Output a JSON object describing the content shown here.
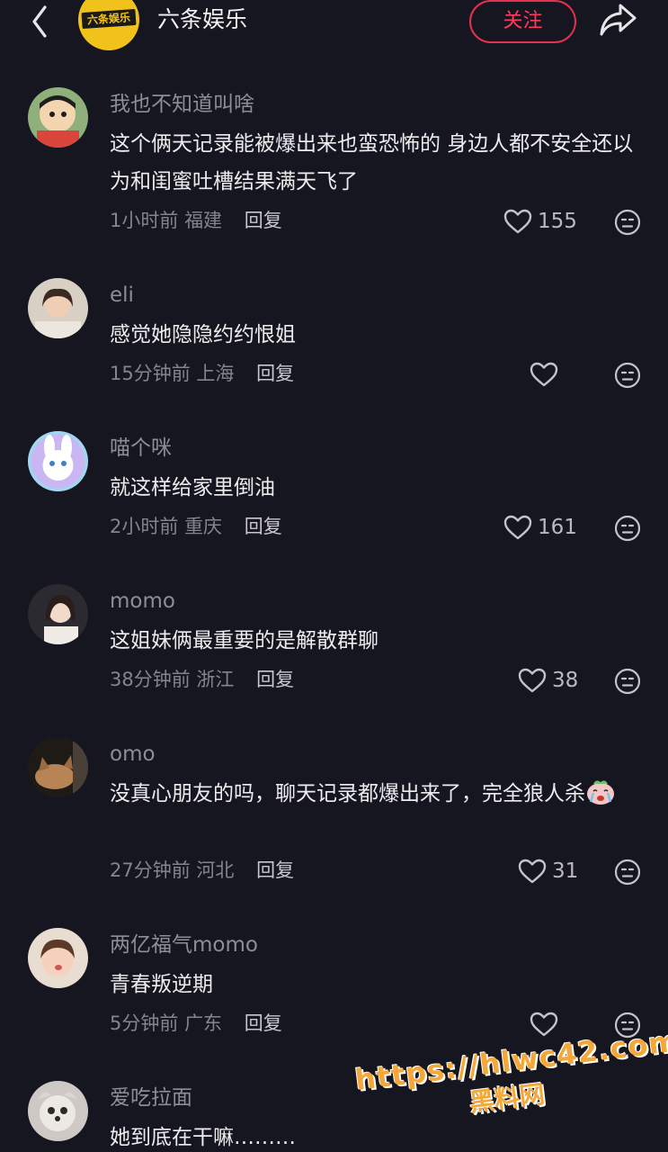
{
  "header": {
    "logo_text": "六条娱乐",
    "account_name": "六条娱乐",
    "follow_label": "关注"
  },
  "comments": [
    {
      "username": "我也不知道叫啥",
      "text": "这个俩天记录能被爆出来也蛮恐怖的 身边人都不安全还以为和闺蜜吐槽结果满天飞了",
      "time": "1小时前",
      "location": "福建",
      "reply_label": "回复",
      "likes": "155"
    },
    {
      "username": "eli",
      "text": "感觉她隐隐约约恨姐",
      "time": "15分钟前",
      "location": "上海",
      "reply_label": "回复",
      "likes": ""
    },
    {
      "username": "喵个咪",
      "text": "就这样给家里倒油",
      "time": "2小时前",
      "location": "重庆",
      "reply_label": "回复",
      "likes": "161"
    },
    {
      "username": "momo",
      "text": "这姐妹俩最重要的是解散群聊",
      "time": "38分钟前",
      "location": "浙江",
      "reply_label": "回复",
      "likes": "38"
    },
    {
      "username": "omo",
      "text": "没真心朋友的吗，聊天记录都爆出来了，完全狼人杀",
      "time": "27分钟前",
      "location": "河北",
      "reply_label": "回复",
      "likes": "31"
    },
    {
      "username": "两亿福气momo",
      "text": "青春叛逆期",
      "time": "5分钟前",
      "location": "广东",
      "reply_label": "回复",
      "likes": ""
    },
    {
      "username": "爱吃拉面",
      "text": "她到底在干嘛………"
    }
  ],
  "watermark": {
    "url": "https://hlwc42.com",
    "sub": "黑料网"
  },
  "colors": {
    "background": "#161620",
    "accent": "#e5304f",
    "watermark": "#f5a83a"
  },
  "icons": {
    "back": "chevron-left-icon",
    "share": "share-arrow-icon",
    "like": "heart-outline-icon",
    "dislike": "neutral-face-icon"
  }
}
